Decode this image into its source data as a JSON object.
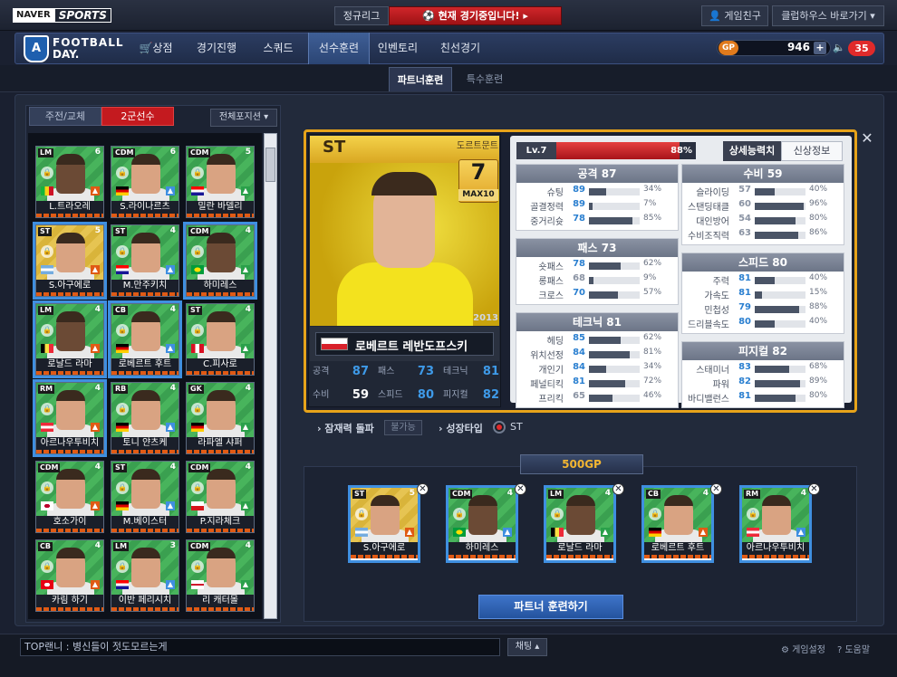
{
  "topbar": {
    "brand_naver": "NAVER",
    "brand_sports": "SPORTS",
    "league_label": "정규리그",
    "live_label": "⚽ 현재 경기중입니다! ▸",
    "friends_label": "게임친구",
    "clubhouse_label": "클럽하우스 바로가기 ▾"
  },
  "nav": {
    "logo_line1": "FOOTBALL",
    "logo_line2": "DAY.",
    "items": [
      "상점",
      "경기진행",
      "스쿼드",
      "선수훈련",
      "인벤토리",
      "친선경기"
    ],
    "active": "선수훈련",
    "gp_label": "GP",
    "gp_value": "946",
    "notifications": "35"
  },
  "subtabs": [
    "파트너훈련",
    "특수훈련"
  ],
  "left": {
    "tab_main": "주전/교체",
    "tab_sub": "2군선수",
    "position_filter": "전체포지션 ▾",
    "players": [
      {
        "pos": "LM",
        "lvl": "6",
        "name": "L.트라오레",
        "flag": "mali",
        "sel": false,
        "dark": true
      },
      {
        "pos": "CDM",
        "lvl": "6",
        "name": "S.라이나르츠",
        "flag": "germany",
        "sel": false,
        "dark": false
      },
      {
        "pos": "CDM",
        "lvl": "5",
        "name": "밀란 바델리",
        "flag": "croatia",
        "sel": false,
        "dark": false
      },
      {
        "pos": "ST",
        "lvl": "5",
        "name": "S.아구에로",
        "flag": "argentina",
        "sel": true,
        "dark": false,
        "gold": true
      },
      {
        "pos": "ST",
        "lvl": "4",
        "name": "M.만주키치",
        "flag": "croatia",
        "sel": false,
        "dark": false
      },
      {
        "pos": "CDM",
        "lvl": "4",
        "name": "하미레스",
        "flag": "brazil",
        "sel": true,
        "dark": true
      },
      {
        "pos": "LM",
        "lvl": "4",
        "name": "로날드 라마",
        "flag": "belgium",
        "sel": true,
        "dark": true
      },
      {
        "pos": "CB",
        "lvl": "4",
        "name": "로베르트 후트",
        "flag": "germany",
        "sel": true,
        "dark": false
      },
      {
        "pos": "ST",
        "lvl": "4",
        "name": "C.피사로",
        "flag": "peru",
        "sel": false,
        "dark": false
      },
      {
        "pos": "RM",
        "lvl": "4",
        "name": "아르나우투비치",
        "flag": "austria",
        "sel": true,
        "dark": false
      },
      {
        "pos": "RB",
        "lvl": "4",
        "name": "토니 얀츠케",
        "flag": "germany",
        "sel": false,
        "dark": false
      },
      {
        "pos": "GK",
        "lvl": "4",
        "name": "라파엘 샤퍼",
        "flag": "germany",
        "sel": false,
        "dark": false
      },
      {
        "pos": "CDM",
        "lvl": "4",
        "name": "호소가이",
        "flag": "japan",
        "sel": false,
        "dark": false
      },
      {
        "pos": "ST",
        "lvl": "4",
        "name": "M.베이스터",
        "flag": "germany",
        "sel": false,
        "dark": false
      },
      {
        "pos": "CDM",
        "lvl": "4",
        "name": "P.지라체크",
        "flag": "czech",
        "sel": false,
        "dark": false
      },
      {
        "pos": "CB",
        "lvl": "4",
        "name": "카림 하기",
        "flag": "tunisia",
        "sel": false,
        "dark": false
      },
      {
        "pos": "LM",
        "lvl": "3",
        "name": "이반 페리시치",
        "flag": "croatia",
        "sel": false,
        "dark": false
      },
      {
        "pos": "CDM",
        "lvl": "4",
        "name": "리 캐터몰",
        "flag": "england",
        "sel": false,
        "dark": false
      }
    ]
  },
  "detail": {
    "position": "ST",
    "club": "도르트문트",
    "grade": "7",
    "grade_max": "MAX10",
    "year": "2013",
    "name": "로베르트 레반도프스키",
    "summary": [
      {
        "label": "공격",
        "value": "87",
        "color": "blue"
      },
      {
        "label": "패스",
        "value": "73",
        "color": "blue"
      },
      {
        "label": "테크닉",
        "value": "81",
        "color": "blue"
      },
      {
        "label": "수비",
        "value": "59",
        "color": "white"
      },
      {
        "label": "스피드",
        "value": "80",
        "color": "blue"
      },
      {
        "label": "피지컬",
        "value": "82",
        "color": "blue"
      }
    ],
    "level": "Lv.7",
    "level_pct": "88%",
    "level_fraction": 0.88,
    "tab_detail": "상세능력치",
    "tab_info": "신상정보",
    "groups_left": [
      {
        "title": "공격 87",
        "rows": [
          {
            "l": "슈팅",
            "v": "89",
            "p": "34%",
            "f": 0.34
          },
          {
            "l": "골결정력",
            "v": "89",
            "p": "7%",
            "f": 0.07
          },
          {
            "l": "중거리슛",
            "v": "78",
            "p": "85%",
            "f": 0.85
          }
        ]
      },
      {
        "title": "패스 73",
        "rows": [
          {
            "l": "숏패스",
            "v": "78",
            "p": "62%",
            "f": 0.62
          },
          {
            "l": "롱패스",
            "v": "68",
            "p": "9%",
            "f": 0.09,
            "gray": true
          },
          {
            "l": "크로스",
            "v": "70",
            "p": "57%",
            "f": 0.57
          }
        ]
      },
      {
        "title": "테크닉 81",
        "rows": [
          {
            "l": "헤딩",
            "v": "85",
            "p": "62%",
            "f": 0.62
          },
          {
            "l": "위치선정",
            "v": "84",
            "p": "81%",
            "f": 0.81
          },
          {
            "l": "개인기",
            "v": "84",
            "p": "34%",
            "f": 0.34
          },
          {
            "l": "페널티킥",
            "v": "81",
            "p": "72%",
            "f": 0.72
          },
          {
            "l": "프리킥",
            "v": "65",
            "p": "46%",
            "f": 0.46,
            "gray": true
          }
        ]
      }
    ],
    "groups_right": [
      {
        "title": "수비 59",
        "rows": [
          {
            "l": "슬라이딩",
            "v": "57",
            "p": "40%",
            "f": 0.4,
            "gray": true
          },
          {
            "l": "스탠딩태클",
            "v": "60",
            "p": "96%",
            "f": 0.96,
            "gray": true
          },
          {
            "l": "대인방어",
            "v": "54",
            "p": "80%",
            "f": 0.8,
            "gray": true
          },
          {
            "l": "수비조직력",
            "v": "63",
            "p": "86%",
            "f": 0.86,
            "gray": true
          }
        ]
      },
      {
        "title": "스피드 80",
        "rows": [
          {
            "l": "주력",
            "v": "81",
            "p": "40%",
            "f": 0.4
          },
          {
            "l": "가속도",
            "v": "81",
            "p": "15%",
            "f": 0.15
          },
          {
            "l": "민첩성",
            "v": "79",
            "p": "88%",
            "f": 0.88
          },
          {
            "l": "드리블속도",
            "v": "80",
            "p": "40%",
            "f": 0.4
          }
        ]
      },
      {
        "title": "피지컬 82",
        "rows": [
          {
            "l": "스태미너",
            "v": "83",
            "p": "68%",
            "f": 0.68
          },
          {
            "l": "파워",
            "v": "82",
            "p": "89%",
            "f": 0.89
          },
          {
            "l": "바디밸런스",
            "v": "81",
            "p": "80%",
            "f": 0.8
          }
        ]
      }
    ],
    "potential_label": "잠재력 돌파",
    "potential_value": "불가능",
    "growth_label": "성장타입",
    "growth_value": "ST"
  },
  "partners": {
    "cost": "500GP",
    "train_button": "파트너 훈련하기",
    "cards": [
      {
        "pos": "ST",
        "lvl": "5",
        "name": "S.아구에로",
        "flag": "argentina",
        "gold": true
      },
      {
        "pos": "CDM",
        "lvl": "4",
        "name": "하미레스",
        "flag": "brazil",
        "dark": true
      },
      {
        "pos": "LM",
        "lvl": "4",
        "name": "로날드 라마",
        "flag": "belgium",
        "dark": true
      },
      {
        "pos": "CB",
        "lvl": "4",
        "name": "로베르트 후트",
        "flag": "germany"
      },
      {
        "pos": "RM",
        "lvl": "4",
        "name": "아르나우투비치",
        "flag": "austria"
      }
    ]
  },
  "footer": {
    "chat_text": "TOP랜니 : 병신들이 젓도모르는게",
    "chat_button": "채팅 ▴",
    "settings": "⚙ 게임설정",
    "help": "? 도움말"
  },
  "colors": {
    "accent_red": "#c41a1f",
    "accent_gold": "#e7a31a",
    "stat_blue": "#2a7fd0",
    "selected_blue": "#3f8fe0"
  }
}
